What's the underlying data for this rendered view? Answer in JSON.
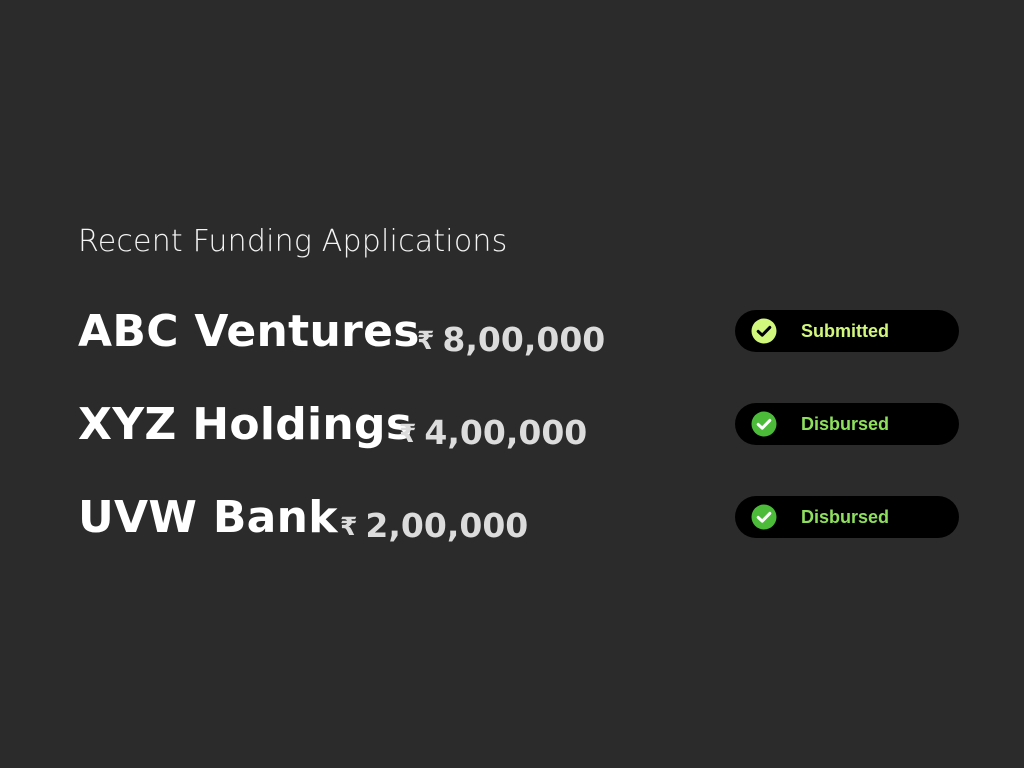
{
  "section": {
    "title": "Recent Funding Applications"
  },
  "applications": [
    {
      "company": "ABC Ventures",
      "currency_symbol": "₹",
      "amount": "8,00,000",
      "status": {
        "label": "Submitted",
        "icon": "check-circle-icon",
        "text_color": "#d2f77d",
        "icon_color": "#d2f77d"
      }
    },
    {
      "company": "XYZ Holdings",
      "currency_symbol": "₹",
      "amount": "4,00,000",
      "status": {
        "label": "Disbursed",
        "icon": "check-circle-icon",
        "text_color": "#8ee05c",
        "icon_color": "#4cbb3a"
      }
    },
    {
      "company": "UVW Bank",
      "currency_symbol": "₹",
      "amount": "2,00,000",
      "status": {
        "label": "Disbursed",
        "icon": "check-circle-icon",
        "text_color": "#8ee05c",
        "icon_color": "#4cbb3a"
      }
    }
  ],
  "colors": {
    "background": "#2b2b2b",
    "pill_background": "#000000",
    "company_text": "#ffffff",
    "amount_text": "#dcdcdc"
  }
}
